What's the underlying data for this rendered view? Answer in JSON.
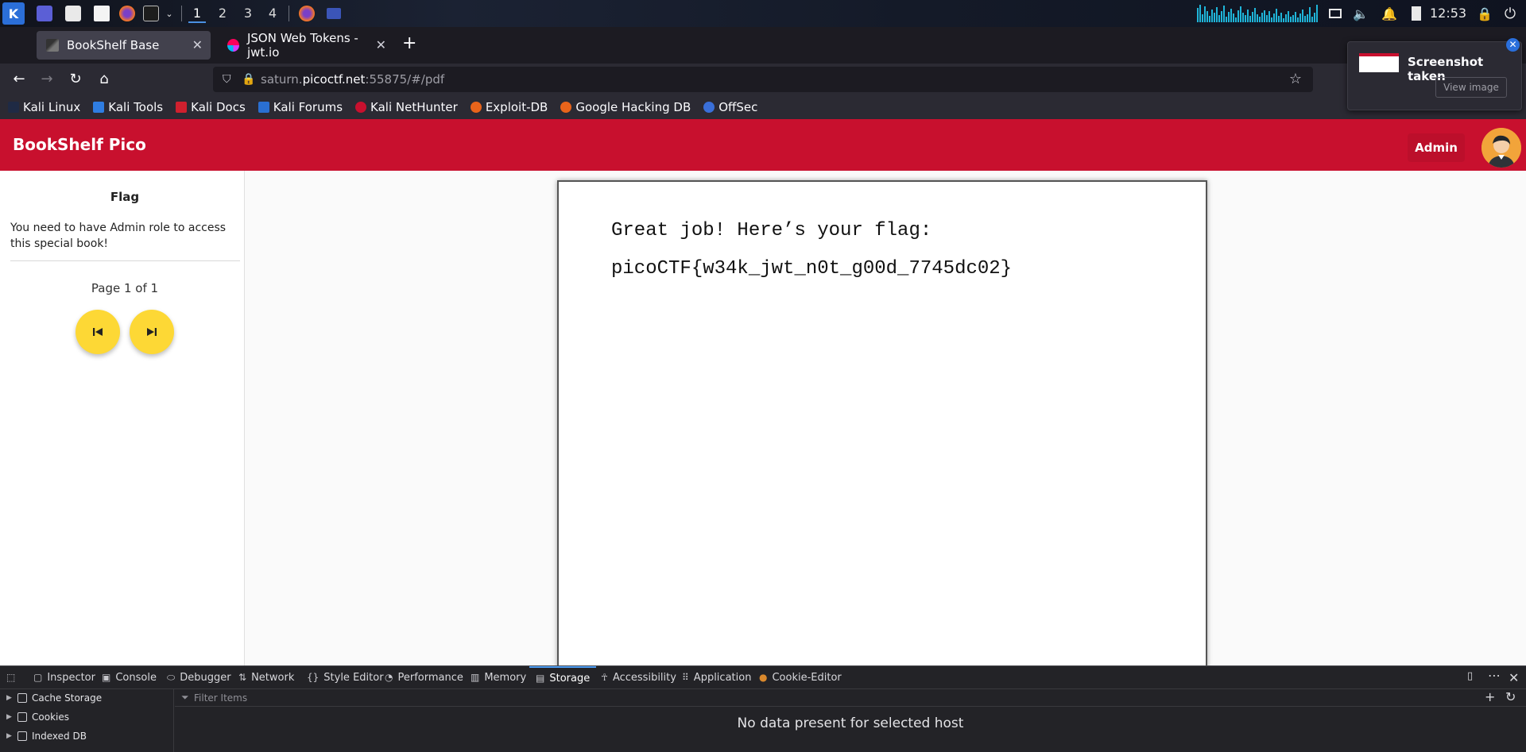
{
  "taskbar": {
    "workspaces": [
      "1",
      "2",
      "3",
      "4"
    ],
    "clock": "12:53"
  },
  "browser": {
    "tabs": [
      {
        "title": "BookShelf Base",
        "active": true
      },
      {
        "title": "JSON Web Tokens - jwt.io",
        "active": false
      }
    ],
    "new_tab": "+",
    "url": {
      "prefix": "saturn.",
      "domain": "picoctf.net",
      "suffix": ":55875/#/pdf"
    },
    "bookmarks": [
      "Kali Linux",
      "Kali Tools",
      "Kali Docs",
      "Kali Forums",
      "Kali NetHunter",
      "Exploit-DB",
      "Google Hacking DB",
      "OffSec"
    ]
  },
  "notification": {
    "title": "Screenshot taken",
    "button": "View image"
  },
  "app": {
    "title": "BookShelf Pico",
    "role_button": "Admin",
    "sidebar": {
      "title": "Flag",
      "message": "You need to have Admin role to access this special book!",
      "page_indicator": "Page 1 of 1"
    },
    "pdf": {
      "line1": "Great job! Here’s your flag:",
      "line2": "picoCTF{w34k_jwt_n0t_g00d_7745dc02}"
    }
  },
  "devtools": {
    "tabs": [
      "Inspector",
      "Console",
      "Debugger",
      "Network",
      "Style Editor",
      "Performance",
      "Memory",
      "Storage",
      "Accessibility",
      "Application",
      "Cookie-Editor"
    ],
    "active_tab": "Storage",
    "tree": [
      "Cache Storage",
      "Cookies",
      "Indexed DB"
    ],
    "filter_placeholder": "Filter Items",
    "empty_message": "No data present for selected host"
  },
  "colors": {
    "brand_red": "#c8102e",
    "fab_yellow": "#fdd835",
    "devtools_accent": "#4c9ef6"
  }
}
